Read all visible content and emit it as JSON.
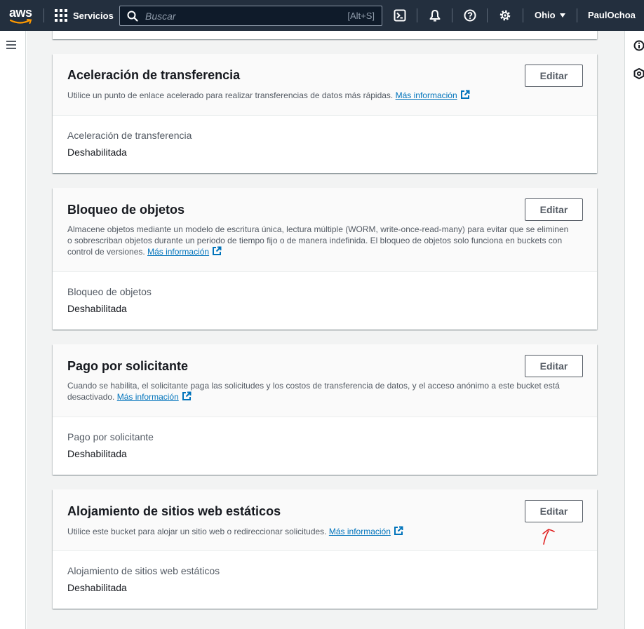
{
  "topnav": {
    "logo_text": "aws",
    "services_label": "Servicios",
    "search_placeholder": "Buscar",
    "search_shortcut": "[Alt+S]",
    "region_label": "Ohio",
    "user_label": "PaulOchoa",
    "icons": [
      "cloudshell-icon",
      "bell-icon",
      "help-icon",
      "gear-icon"
    ]
  },
  "sections": [
    {
      "title": "Aceleración de transferencia",
      "description": "Utilice un punto de enlace acelerado para realizar transferencias de datos más rápidas.",
      "link_text": "Más información",
      "edit_label": "Editar",
      "field_label": "Aceleración de transferencia",
      "field_value": "Deshabilitada"
    },
    {
      "title": "Bloqueo de objetos",
      "description": "Almacene objetos mediante un modelo de escritura única, lectura múltiple (WORM, write-once-read-many) para evitar que se eliminen o sobrescriban objetos durante un periodo de tiempo fijo o de manera indefinida. El bloqueo de objetos solo funciona en buckets con control de versiones.",
      "link_text": "Más información",
      "edit_label": "Editar",
      "field_label": "Bloqueo de objetos",
      "field_value": "Deshabilitada"
    },
    {
      "title": "Pago por solicitante",
      "description": "Cuando se habilita, el solicitante paga las solicitudes y los costos de transferencia de datos, y el acceso anónimo a este bucket está desactivado.",
      "link_text": "Más información",
      "edit_label": "Editar",
      "field_label": "Pago por solicitante",
      "field_value": "Deshabilitada"
    },
    {
      "title": "Alojamiento de sitios web estáticos",
      "description": "Utilice este bucket para alojar un sitio web o redireccionar solicitudes.",
      "link_text": "Más información",
      "edit_label": "Editar",
      "field_label": "Alojamiento de sitios web estáticos",
      "field_value": "Deshabilitada"
    }
  ],
  "colors": {
    "nav_bg": "#232f3e",
    "link": "#0073bb",
    "page_bg": "#f2f3f3",
    "annotation": "#e02020"
  }
}
